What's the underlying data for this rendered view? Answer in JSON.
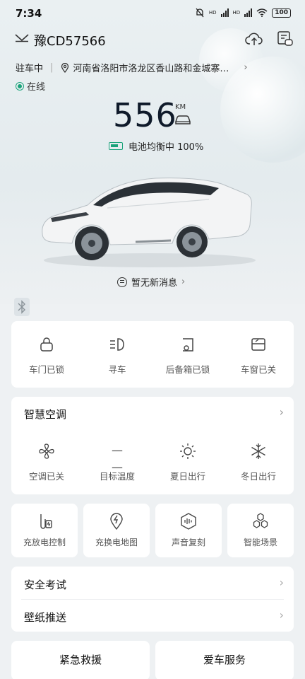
{
  "status_bar": {
    "time": "7:34",
    "net1": "HD",
    "net2": "HD",
    "battery": "100"
  },
  "header": {
    "plate": "豫CD57566",
    "icons": [
      "chevron-down-icon",
      "cloud-upload-icon",
      "message-box-icon"
    ]
  },
  "location": {
    "state": "驻车中",
    "address": "河南省洛阳市洛龙区香山路和金城寨街…",
    "arrow": "›"
  },
  "online": {
    "label": "在线",
    "color": "#1aa37a"
  },
  "range": {
    "value": "556",
    "unit": "KM"
  },
  "battery": {
    "label": "电池均衡中 100%"
  },
  "messages": {
    "label": "暂无新消息",
    "arrow": "›"
  },
  "status_tiles": [
    {
      "label": "车门已锁",
      "icon": "lock-icon"
    },
    {
      "label": "寻车",
      "icon": "headlight-icon"
    },
    {
      "label": "后备箱已锁",
      "icon": "trunk-icon"
    },
    {
      "label": "车窗已关",
      "icon": "window-icon"
    }
  ],
  "climate": {
    "title": "智慧空调",
    "arrow": "›",
    "items": [
      {
        "label": "空调已关",
        "icon": "fan-icon"
      },
      {
        "label": "目标温度",
        "icon": "dash-icon",
        "value": "— —"
      },
      {
        "label": "夏日出行",
        "icon": "sun-icon"
      },
      {
        "label": "冬日出行",
        "icon": "snowflake-icon"
      }
    ]
  },
  "feature_tiles": [
    {
      "label": "充放电控制",
      "icon": "charge-control-icon"
    },
    {
      "label": "充换电地图",
      "icon": "charge-map-icon"
    },
    {
      "label": "声音复刻",
      "icon": "sound-wave-icon"
    },
    {
      "label": "智能场景",
      "icon": "scene-hexagons-icon"
    }
  ],
  "list": [
    {
      "label": "安全考试",
      "arrow": "›"
    },
    {
      "label": "壁纸推送",
      "arrow": "›"
    }
  ],
  "bottom": {
    "left": "紧急救援",
    "right": "爱车服务"
  }
}
